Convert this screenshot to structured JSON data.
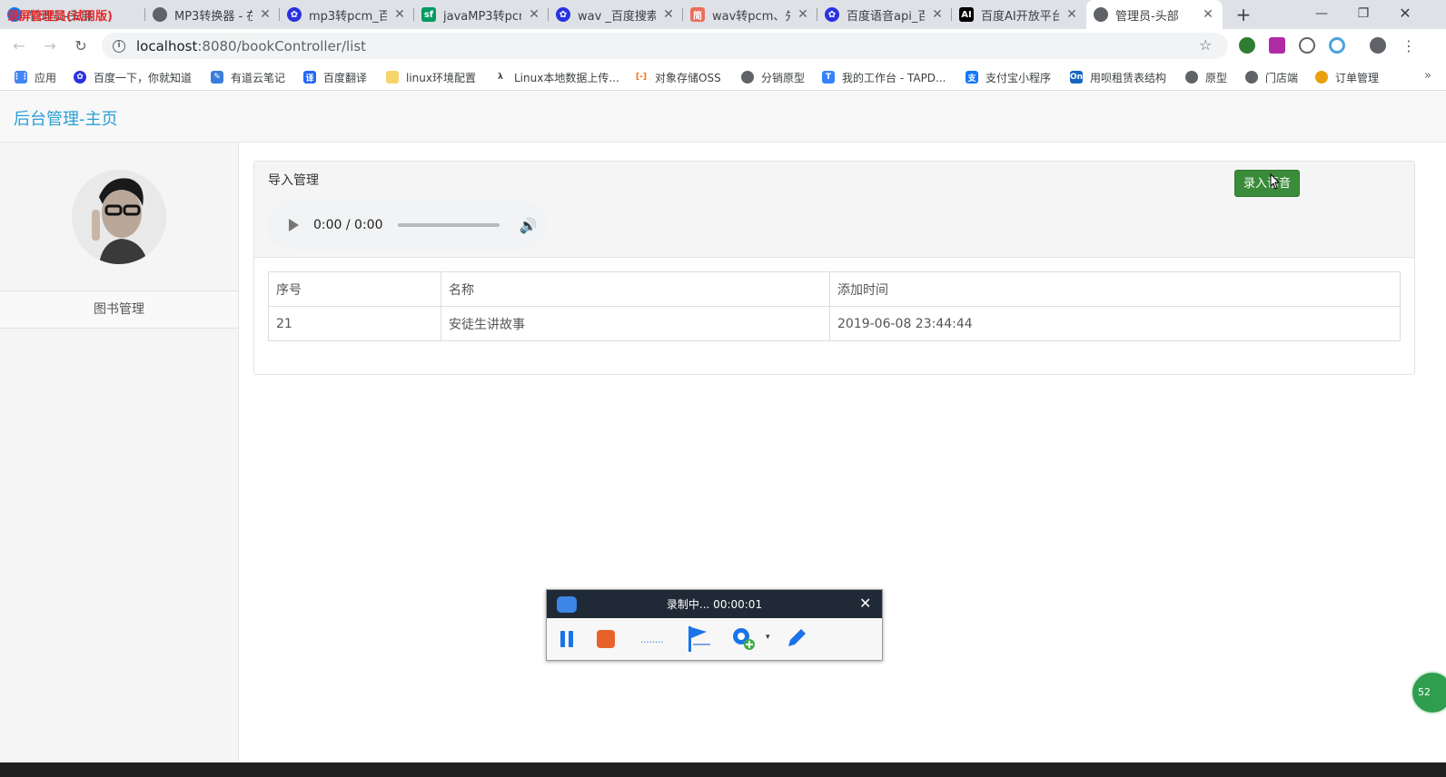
{
  "browser": {
    "tabs": [
      {
        "title": "管理员-头部",
        "color": "#1a73e8"
      },
      {
        "title": "MP3转换器 - 在",
        "color": "#5f6368"
      },
      {
        "title": "mp3转pcm_百",
        "color": "#2932e1"
      },
      {
        "title": "javaMP3转pcm",
        "color": "#009a61"
      },
      {
        "title": "wav _百度搜索",
        "color": "#2932e1"
      },
      {
        "title": "wav转pcm、先",
        "color": "#ea6f5a"
      },
      {
        "title": "百度语音api_百",
        "color": "#2932e1"
      },
      {
        "title": "百度AI开放平台",
        "color": "#000000"
      },
      {
        "title": "管理员-头部",
        "color": "#5f6368"
      }
    ],
    "watermark": "录屏管理员(试用版)",
    "address": {
      "host": "localhost",
      "path": ":8080/bookController/list"
    },
    "bookmarks": [
      {
        "label": "应用",
        "color": "#4285f4"
      },
      {
        "label": "百度一下，你就知道",
        "color": "#2932e1"
      },
      {
        "label": "有道云笔记",
        "color": "#3b7ddd"
      },
      {
        "label": "百度翻译",
        "color": "#2468f2"
      },
      {
        "label": "linux环境配置",
        "color": "#f6d36b"
      },
      {
        "label": "Linux本地数据上传...",
        "color": "#444444"
      },
      {
        "label": "对象存储OSS",
        "color": "#ff6a00"
      },
      {
        "label": "分销原型",
        "color": "#5f6368"
      },
      {
        "label": "我的工作台 - TAPD...",
        "color": "#3582fb"
      },
      {
        "label": "支付宝小程序",
        "color": "#1677ff"
      },
      {
        "label": "用呗租赁表结构",
        "color": "#1565c0"
      },
      {
        "label": "原型",
        "color": "#5f6368"
      },
      {
        "label": "门店端",
        "color": "#5f6368"
      },
      {
        "label": "订单管理",
        "color": "#e8a10c"
      }
    ],
    "more_label": "»"
  },
  "page": {
    "brand": "后台管理-主页",
    "sidebar_menu": [
      "图书管理"
    ],
    "panel_title": "导入管理",
    "audio_time": "0:00 / 0:00",
    "record_button": "录入语音",
    "table": {
      "headers": [
        "序号",
        "名称",
        "添加时间"
      ],
      "rows": [
        [
          "21",
          "安徒生讲故事",
          "2019-06-08 23:44:44"
        ]
      ]
    }
  },
  "recorder": {
    "status": "录制中... 00:00:01",
    "dots": "........"
  },
  "edge_badge": "52"
}
